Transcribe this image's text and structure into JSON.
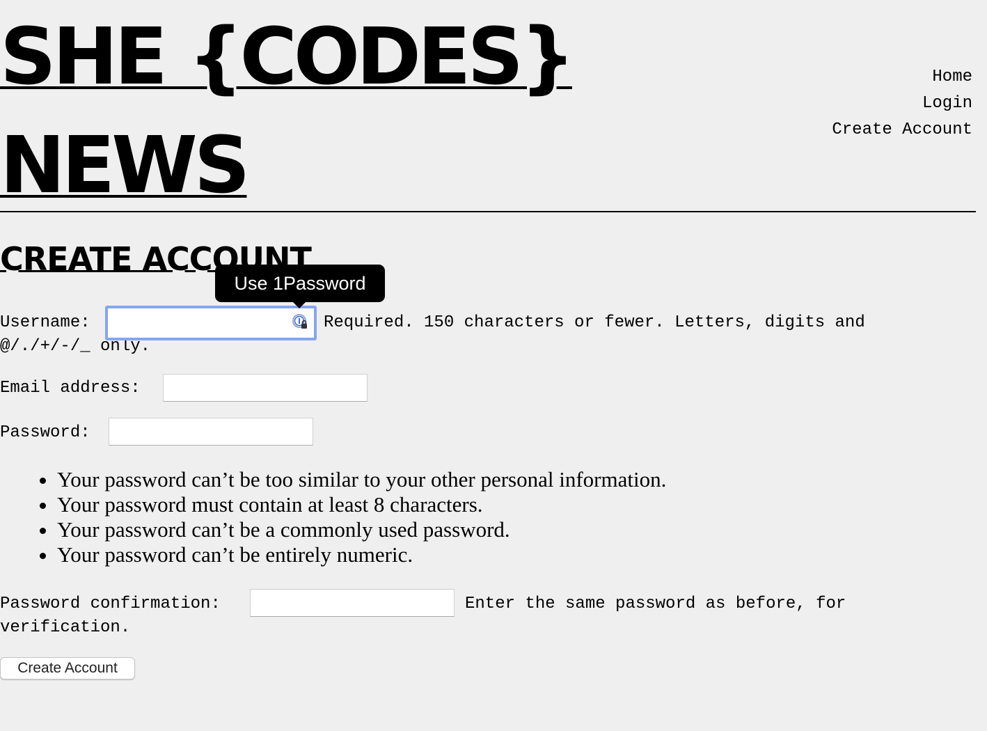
{
  "header": {
    "site_title_line1": "SHE {CODES}",
    "site_title_line2": "NEWS",
    "nav": {
      "home": "Home",
      "login": "Login",
      "create_account": "Create Account"
    }
  },
  "page": {
    "heading": "CREATE ACCOUNT"
  },
  "password_manager": {
    "tooltip": "Use 1Password",
    "icon": "1password-icon",
    "accent": "#85a6ef"
  },
  "form": {
    "username": {
      "label": "Username:",
      "value": "",
      "help_line1": "Required. 150 characters or fewer. Letters, digits and",
      "help_line2": "@/./+/-/_ only."
    },
    "email": {
      "label": "Email address:",
      "value": ""
    },
    "password": {
      "label": "Password:",
      "value": "",
      "rules": [
        "Your password can’t be too similar to your other personal information.",
        "Your password must contain at least 8 characters.",
        "Your password can’t be a commonly used password.",
        "Your password can’t be entirely numeric."
      ]
    },
    "password_confirmation": {
      "label": "Password confirmation:",
      "value": "",
      "help_line1": "Enter the same password as before, for",
      "help_line2": "verification."
    },
    "submit_label": "Create Account"
  }
}
